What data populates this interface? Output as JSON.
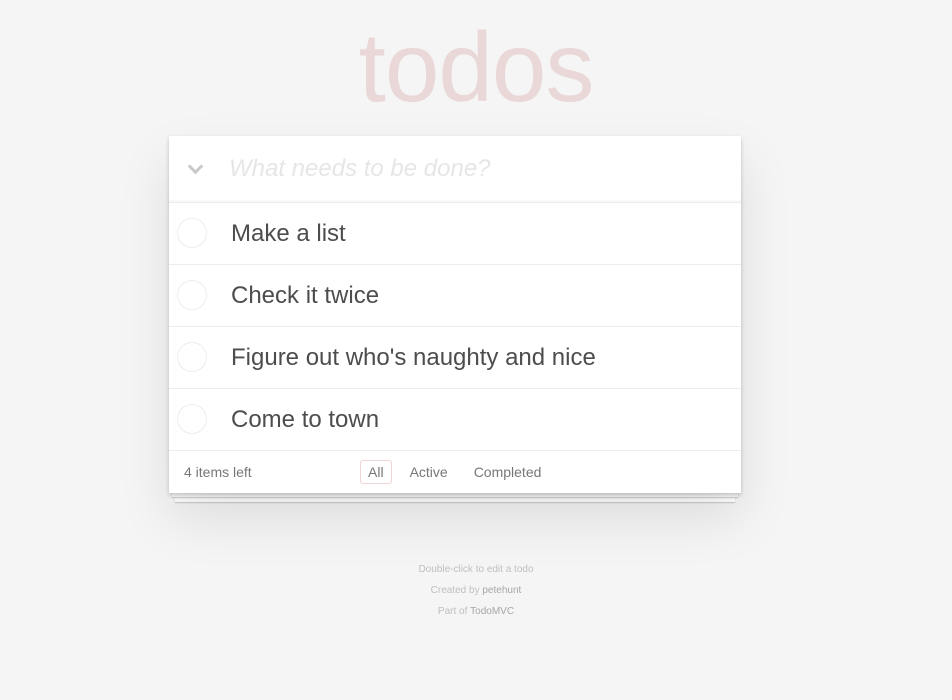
{
  "header": {
    "title": "todos",
    "new_todo_placeholder": "What needs to be done?"
  },
  "todos": [
    {
      "label": "Make a list",
      "completed": false
    },
    {
      "label": "Check it twice",
      "completed": false
    },
    {
      "label": "Figure out who's naughty and nice",
      "completed": false
    },
    {
      "label": "Come to town",
      "completed": false
    }
  ],
  "footer": {
    "count_text": "4 items left",
    "filters": [
      {
        "label": "All",
        "selected": true
      },
      {
        "label": "Active",
        "selected": false
      },
      {
        "label": "Completed",
        "selected": false
      }
    ]
  },
  "info": {
    "edit_hint": "Double-click to edit a todo",
    "created_prefix": "Created by ",
    "created_author": "petehunt",
    "part_prefix": "Part of ",
    "part_link": "TodoMVC"
  },
  "colors": {
    "title": "#e6cfcf",
    "background": "#f5f5f5",
    "selected_filter_border": "#efd5d5"
  },
  "icons": {
    "toggle_all": "chevron-down-icon",
    "todo_toggle": "circle-checkbox-icon"
  }
}
